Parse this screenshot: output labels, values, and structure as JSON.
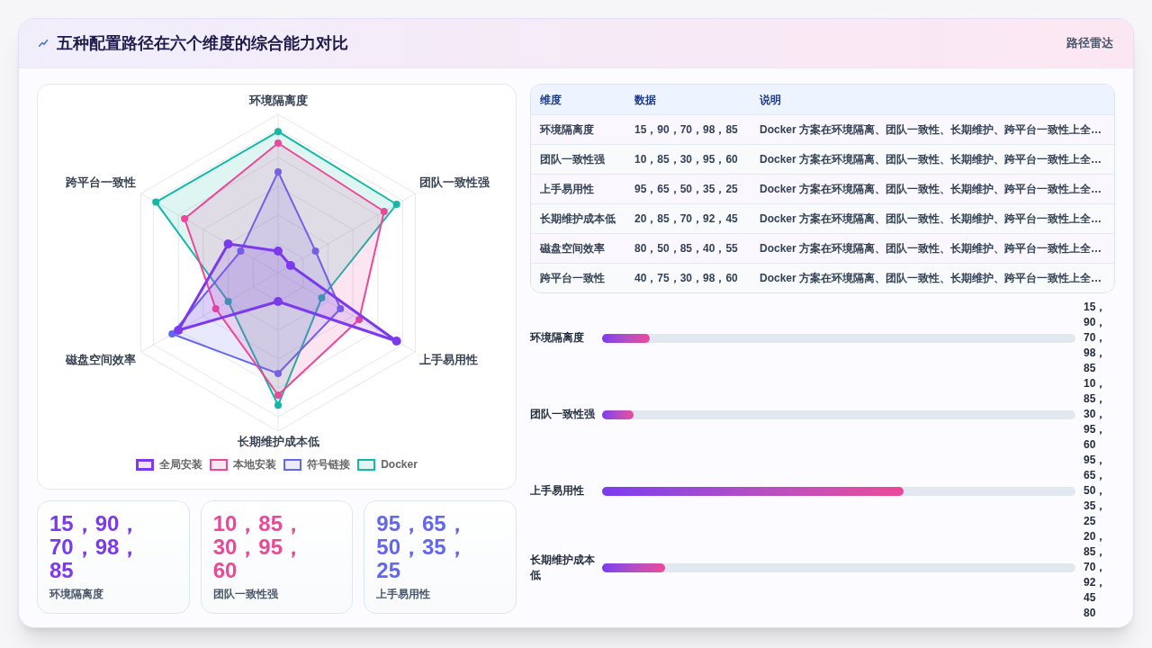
{
  "header": {
    "title": "五种配置路径在六个维度的综合能力对比",
    "tag": "路径雷达"
  },
  "radar": {
    "axes": [
      "环境隔离度",
      "跨平台一致性",
      "团队一致性强",
      "磁盘空间效率",
      "上手易用性",
      "长期维护成本低"
    ],
    "legend": [
      {
        "label": "全局安装",
        "color": "#7c3aed",
        "emphasized": true
      },
      {
        "label": "本地安装",
        "color": "#ec4899",
        "emphasized": false
      },
      {
        "label": "符号链接",
        "color": "#6366f1",
        "emphasized": false
      },
      {
        "label": "Docker",
        "color": "#14b8a6",
        "emphasized": false
      }
    ]
  },
  "stat_cards": [
    {
      "value": "15，90，70，98，85",
      "label": "环境隔离度",
      "color": "#7c3aed"
    },
    {
      "value": "10，85，30，95，60",
      "label": "团队一致性强",
      "color": "#ec4899"
    },
    {
      "value": "95，65，50，35，25",
      "label": "上手易用性",
      "color": "#6366f1"
    }
  ],
  "table": {
    "columns": [
      "维度",
      "数据",
      "说明"
    ],
    "rows": [
      [
        "环境隔离度",
        "15，90，70，98，85",
        "Docker 方案在环境隔离、团队一致性、长期维护、跨平台一致性上全…"
      ],
      [
        "团队一致性强",
        "10，85，30，95，60",
        "Docker 方案在环境隔离、团队一致性、长期维护、跨平台一致性上全…"
      ],
      [
        "上手易用性",
        "95，65，50，35，25",
        "Docker 方案在环境隔离、团队一致性、长期维护、跨平台一致性上全…"
      ],
      [
        "长期维护成本低",
        "20，85，70，92，45",
        "Docker 方案在环境隔离、团队一致性、长期维护、跨平台一致性上全…"
      ],
      [
        "磁盘空间效率",
        "80，50，85，40，55",
        "Docker 方案在环境隔离、团队一致性、长期维护、跨平台一致性上全…"
      ],
      [
        "跨平台一致性",
        "40，75，30，98，60",
        "Docker 方案在环境隔离、团队一致性、长期维护、跨平台一致性上全…"
      ]
    ]
  },
  "bars": [
    {
      "label": "环境隔离度",
      "level": 0.1,
      "value": "15，90，70，98，85"
    },
    {
      "label": "团队一致性强",
      "level": 0.067,
      "value": "10，85，30，95，60"
    },
    {
      "label": "上手易用性",
      "level": 0.636,
      "value": "95，65，50，35，25"
    },
    {
      "label": "长期维护成本低",
      "level": 0.133,
      "value": "20，85，70，92，45"
    },
    {
      "value": "80"
    }
  ]
}
